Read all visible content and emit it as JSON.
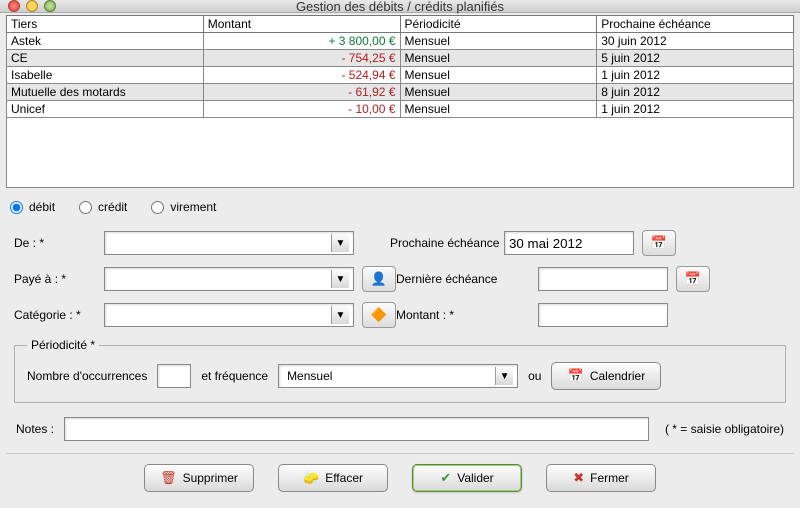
{
  "window": {
    "title": "Gestion des débits / crédits planifiés"
  },
  "table": {
    "headers": {
      "tiers": "Tiers",
      "montant": "Montant",
      "periodicite": "Périodicité",
      "echeance": "Prochaine échéance"
    },
    "rows": [
      {
        "tiers": "Astek",
        "montant": "+ 3 800,00 €",
        "sign": "pos",
        "periodicite": "Mensuel",
        "echeance": "30 juin 2012"
      },
      {
        "tiers": "CE",
        "montant": "- 754,25 €",
        "sign": "neg",
        "periodicite": "Mensuel",
        "echeance": "5 juin 2012"
      },
      {
        "tiers": "Isabelle",
        "montant": "- 524,94 €",
        "sign": "neg",
        "periodicite": "Mensuel",
        "echeance": "1 juin 2012"
      },
      {
        "tiers": "Mutuelle des motards",
        "montant": "- 61,92 €",
        "sign": "neg",
        "periodicite": "Mensuel",
        "echeance": "8 juin 2012"
      },
      {
        "tiers": "Unicef",
        "montant": "- 10,00 €",
        "sign": "neg",
        "periodicite": "Mensuel",
        "echeance": "1 juin 2012"
      }
    ]
  },
  "type_radios": {
    "debit": "débit",
    "credit": "crédit",
    "virement": "virement",
    "selected": "debit"
  },
  "form": {
    "de_label": "De : *",
    "paye_label": "Payé à : *",
    "categorie_label": "Catégorie : *",
    "prochaine_label": "Prochaine échéance",
    "prochaine_value": "30 mai 2012",
    "derniere_label": "Dernière échéance",
    "derniere_value": "",
    "montant_label": "Montant : *",
    "montant_value": ""
  },
  "periodicite": {
    "legend": "Périodicité *",
    "occ_label": "Nombre d'occurrences",
    "freq_label": "et fréquence",
    "freq_value": "Mensuel",
    "ou_label": "ou",
    "calendrier_label": "Calendrier"
  },
  "notes": {
    "label": "Notes :",
    "mandatory_hint": "( * = saisie obligatoire)"
  },
  "buttons": {
    "supprimer": "Supprimer",
    "effacer": "Effacer",
    "valider": "Valider",
    "fermer": "Fermer"
  }
}
